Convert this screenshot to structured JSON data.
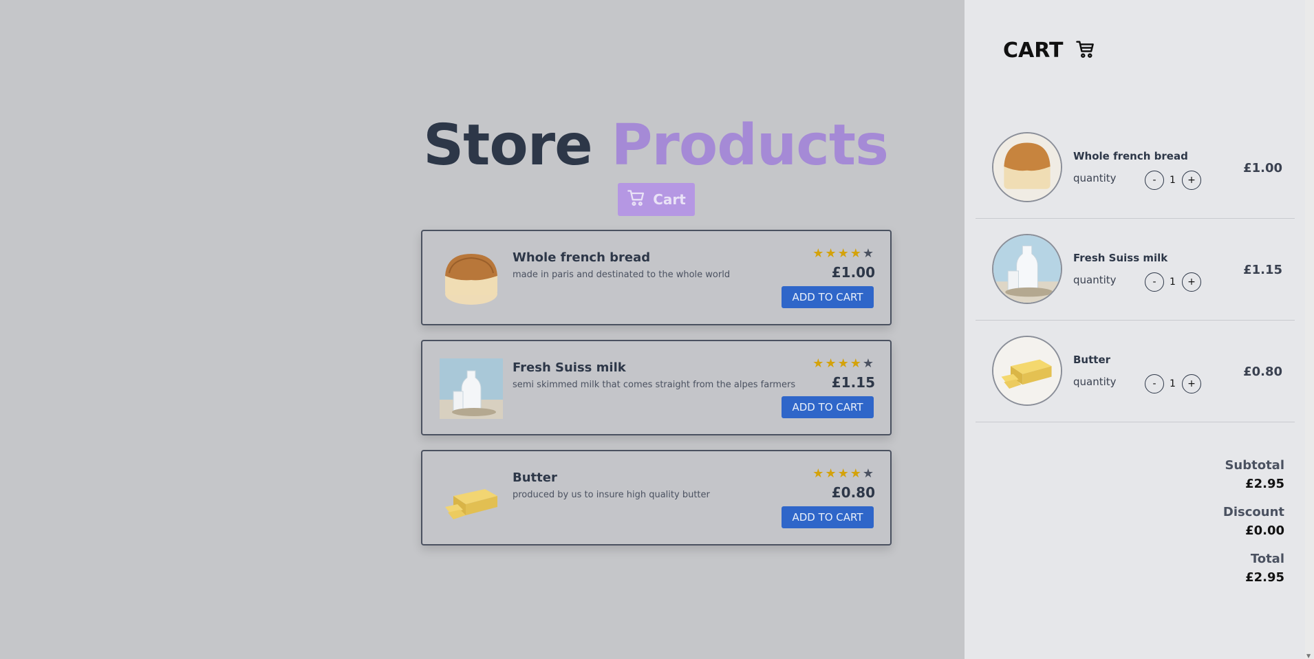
{
  "store": {
    "title_part1": "Store",
    "title_part2": "Products",
    "cart_button_label": "Cart",
    "products": [
      {
        "name": "Whole french bread",
        "description": "made in paris and destinated to the whole world",
        "price": "£1.00",
        "rating": 4,
        "rating_max": 5,
        "add_label": "ADD TO CART"
      },
      {
        "name": "Fresh Suiss milk",
        "description": "semi skimmed milk that comes straight from the alpes farmers",
        "price": "£1.15",
        "rating": 4,
        "rating_max": 5,
        "add_label": "ADD TO CART"
      },
      {
        "name": "Butter",
        "description": "produced by us to insure high quality butter",
        "price": "£0.80",
        "rating": 4,
        "rating_max": 5,
        "add_label": "ADD TO CART"
      }
    ]
  },
  "cart": {
    "title": "CART",
    "quantity_label": "quantity",
    "items": [
      {
        "name": "Whole french bread",
        "quantity": "1",
        "price": "£1.00",
        "minus": "-",
        "plus": "+"
      },
      {
        "name": "Fresh Suiss milk",
        "quantity": "1",
        "price": "£1.15",
        "minus": "-",
        "plus": "+"
      },
      {
        "name": "Butter",
        "quantity": "1",
        "price": "£0.80",
        "minus": "-",
        "plus": "+"
      }
    ],
    "subtotal_label": "Subtotal",
    "subtotal": "£2.95",
    "discount_label": "Discount",
    "discount": "£0.00",
    "total_label": "Total",
    "total": "£2.95"
  },
  "colors": {
    "accent_purple": "#a58ad6",
    "add_button_blue": "#2f66c9",
    "star_gold": "#d4a20a"
  },
  "icons": [
    "cart-icon",
    "star-icon",
    "bread-image",
    "milk-image",
    "butter-image"
  ]
}
